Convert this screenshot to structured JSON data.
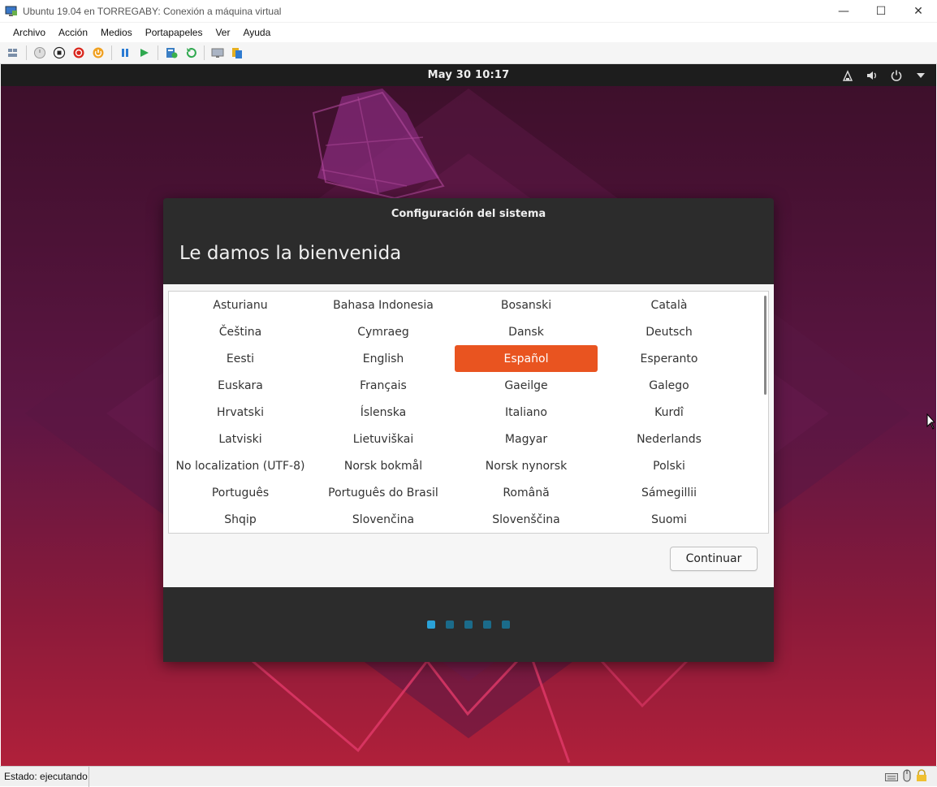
{
  "window": {
    "title": "Ubuntu 19.04 en TORREGABY: Conexión a máquina virtual",
    "minimize": "—",
    "maximize": "☐",
    "close": "✕"
  },
  "menubar": {
    "items": [
      "Archivo",
      "Acción",
      "Medios",
      "Portapapeles",
      "Ver",
      "Ayuda"
    ]
  },
  "topbar": {
    "clock": "May 30  10:17"
  },
  "dialog": {
    "title": "Configuración del sistema",
    "heading": "Le damos la bienvenida",
    "languages": [
      "Asturianu",
      "Bahasa Indonesia",
      "Bosanski",
      "Català",
      "Čeština",
      "Cymraeg",
      "Dansk",
      "Deutsch",
      "Eesti",
      "English",
      "Español",
      "Esperanto",
      "Euskara",
      "Français",
      "Gaeilge",
      "Galego",
      "Hrvatski",
      "Íslenska",
      "Italiano",
      "Kurdî",
      "Latviski",
      "Lietuviškai",
      "Magyar",
      "Nederlands",
      "No localization (UTF-8)",
      "Norsk bokmål",
      "Norsk nynorsk",
      "Polski",
      "Português",
      "Português do Brasil",
      "Română",
      "Sámegillii",
      "Shqip",
      "Slovenčina",
      "Slovenščina",
      "Suomi"
    ],
    "selected_language": "Español",
    "continue_label": "Continuar",
    "steps_total": 5,
    "current_step": 1
  },
  "statusbar": {
    "text": "Estado: ejecutando"
  },
  "colors": {
    "accent": "#e95420",
    "step_active": "#2aa2d8",
    "step_inactive": "#1b6b8a",
    "dialog_bg": "#2c2c2c"
  }
}
